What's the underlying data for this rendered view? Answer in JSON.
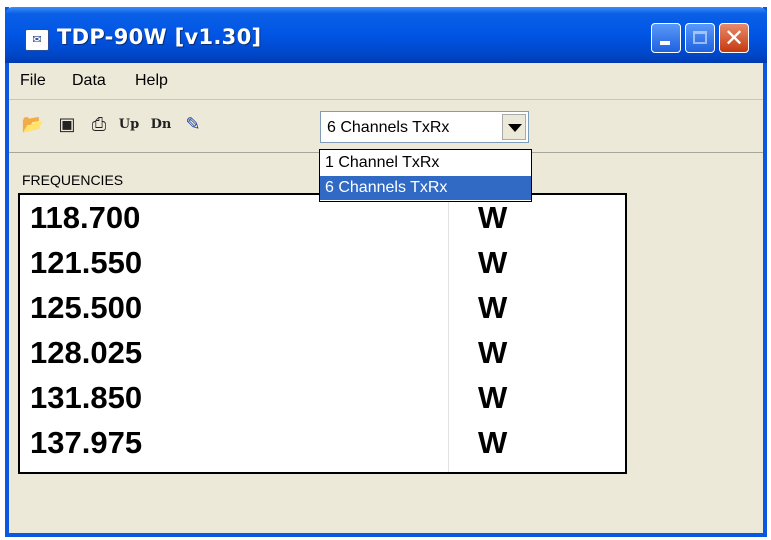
{
  "window": {
    "title": "TDP-90W [v1.30]",
    "icon": "app-icon"
  },
  "menu": {
    "items": [
      "File",
      "Data",
      "Help"
    ]
  },
  "toolbar": {
    "icons": [
      "open-folder-icon",
      "save-disk-icon",
      "printer-icon",
      "upload-up-icon",
      "download-dn-icon",
      "connect-device-icon"
    ],
    "up_label": "Up",
    "dn_label": "Dn",
    "channel_select": {
      "value": "6 Channels TxRx",
      "options": [
        "1 Channel TxRx",
        "6 Channels TxRx"
      ],
      "selected_index": 1
    }
  },
  "frequencies": {
    "label": "FREQUENCIES",
    "rows": [
      {
        "freq": "118.700",
        "mode": "W"
      },
      {
        "freq": "121.550",
        "mode": "W"
      },
      {
        "freq": "125.500",
        "mode": "W"
      },
      {
        "freq": "128.025",
        "mode": "W"
      },
      {
        "freq": "131.850",
        "mode": "W"
      },
      {
        "freq": "137.975",
        "mode": "W"
      }
    ]
  },
  "colors": {
    "titlebar": "#0055e5",
    "window_bg": "#ece9d8",
    "selection": "#316ac5"
  }
}
